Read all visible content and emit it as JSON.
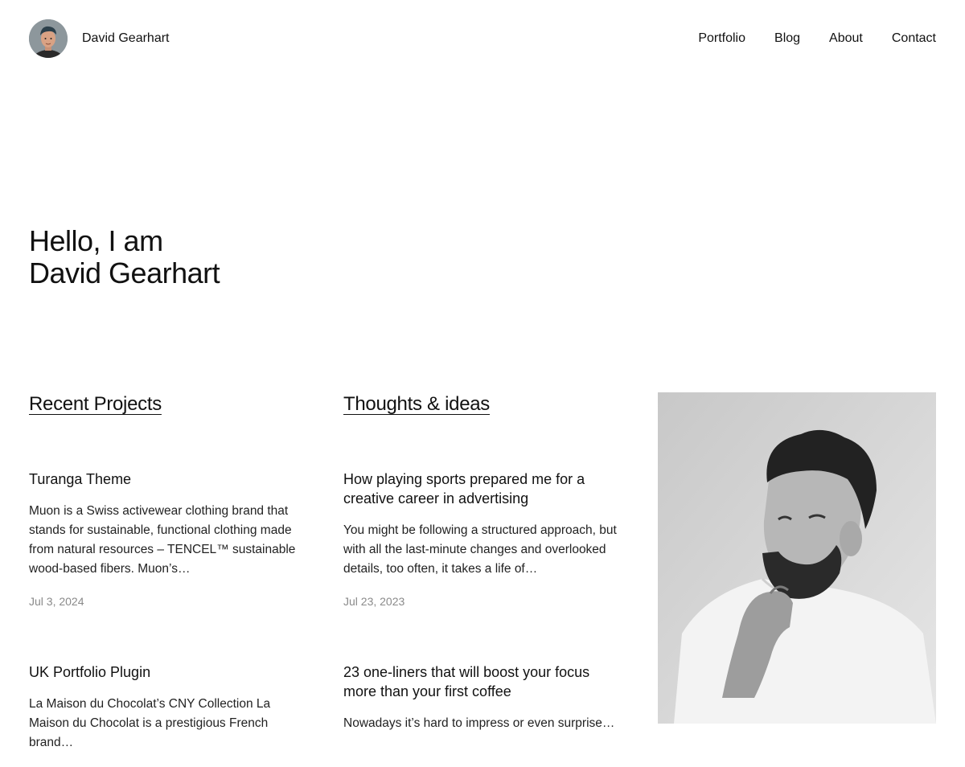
{
  "header": {
    "site_title": "David Gearhart",
    "nav": [
      {
        "label": "Portfolio"
      },
      {
        "label": "Blog"
      },
      {
        "label": "About"
      },
      {
        "label": "Contact"
      }
    ]
  },
  "hero": {
    "line1": "Hello, I am",
    "line2": "David Gearhart"
  },
  "projects": {
    "heading": "Recent Projects",
    "items": [
      {
        "title": "Turanga Theme",
        "excerpt": "Muon is a Swiss activewear clothing brand that stands for sustainable, functional clothing made from natural resources – TENCEL™ sustainable wood-based fibers. Muon’s…",
        "date": "Jul 3, 2024"
      },
      {
        "title": "UK Portfolio Plugin",
        "excerpt": "La Maison du Chocolat’s CNY Collection La Maison du Chocolat is a prestigious French brand…"
      }
    ]
  },
  "thoughts": {
    "heading": "Thoughts & ideas",
    "items": [
      {
        "title": "How playing sports prepared me for a creative career in advertising",
        "excerpt": "You might be following a structured approach, but with all the last-minute changes and overlooked details, too often, it takes a life of…",
        "date": "Jul 23, 2023"
      },
      {
        "title": "23 one-liners that will boost your focus more than your first coffee",
        "excerpt": "Nowadays it’s hard to impress or even surprise…"
      }
    ]
  },
  "colors": {
    "text": "#111111",
    "muted": "#8a8a8a",
    "background": "#ffffff"
  }
}
